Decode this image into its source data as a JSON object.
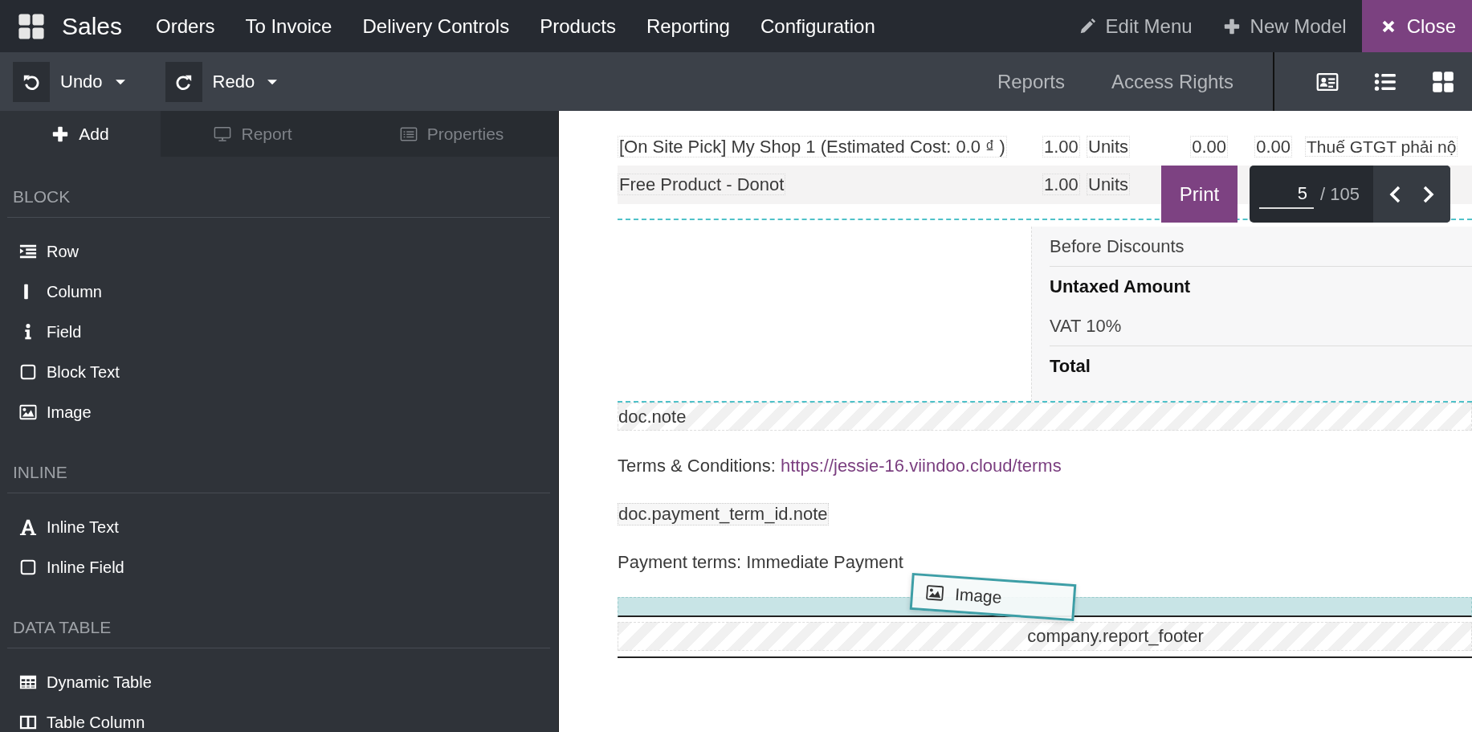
{
  "navbar": {
    "app": "Sales",
    "menu": [
      "Orders",
      "To Invoice",
      "Delivery Controls",
      "Products",
      "Reporting",
      "Configuration"
    ],
    "actions": [
      {
        "kind": "edit",
        "label": "Edit Menu"
      },
      {
        "kind": "add",
        "label": "New Model"
      },
      {
        "kind": "close",
        "label": "Close"
      }
    ]
  },
  "toolbar": {
    "history": [
      {
        "kind": "undo",
        "label": "Undo"
      },
      {
        "kind": "redo",
        "label": "Redo"
      }
    ],
    "links": [
      "Reports",
      "Access Rights"
    ],
    "views": [
      {
        "kind": "form"
      },
      {
        "kind": "list"
      },
      {
        "kind": "kanban"
      }
    ]
  },
  "sidebar": {
    "tabs": [
      {
        "kind": "add",
        "label": "Add",
        "selected": true
      },
      {
        "kind": "report",
        "label": "Report",
        "selected": false
      },
      {
        "kind": "properties",
        "label": "Properties",
        "selected": false
      }
    ],
    "sections": [
      {
        "title": "BLOCK",
        "items": [
          {
            "kind": "row",
            "label": "Row"
          },
          {
            "kind": "column",
            "label": "Column"
          },
          {
            "kind": "field",
            "label": "Field"
          },
          {
            "kind": "block-text",
            "label": "Block Text"
          },
          {
            "kind": "image",
            "label": "Image"
          }
        ]
      },
      {
        "title": "INLINE",
        "items": [
          {
            "kind": "inline-text",
            "label": "Inline Text"
          },
          {
            "kind": "inline-field",
            "label": "Inline Field"
          }
        ]
      },
      {
        "title": "DATA TABLE",
        "items": [
          {
            "kind": "dynamic-table",
            "label": "Dynamic Table"
          },
          {
            "kind": "table-column",
            "label": "Table Column"
          }
        ]
      }
    ]
  },
  "report": {
    "lines": [
      {
        "cells": [
          "[On Site Pick] My Shop 1 (Estimated Cost: 0.0 ₫ )",
          "1.00",
          "Units",
          "0.00",
          "0.00",
          "Thuế GTGT phải nộ"
        ]
      },
      {
        "cells": [
          "Free Product - Donot",
          "1.00",
          "Units"
        ]
      }
    ],
    "print_button": "Print",
    "pager": {
      "value": "5",
      "total": "/ 105"
    },
    "totals": [
      {
        "label": "Before Discounts",
        "bold": false
      },
      {
        "label": "Untaxed Amount",
        "bold": true
      },
      {
        "label": "VAT 10%",
        "bold": false
      },
      {
        "label": "Total",
        "bold": true
      }
    ],
    "blocks": [
      {
        "kind": "placeholder",
        "text": "doc.note"
      },
      {
        "kind": "terms",
        "label": "Terms & Conditions:",
        "link": "https://jessie-16.viindoo.cloud/terms"
      },
      {
        "kind": "field",
        "text": "doc.payment_term_id.note"
      },
      {
        "kind": "text",
        "text": "Payment terms: Immediate Payment"
      },
      {
        "kind": "dropzone"
      },
      {
        "kind": "footer",
        "text": "company.report_footer"
      }
    ],
    "drag_preview": {
      "label": "Image"
    }
  }
}
